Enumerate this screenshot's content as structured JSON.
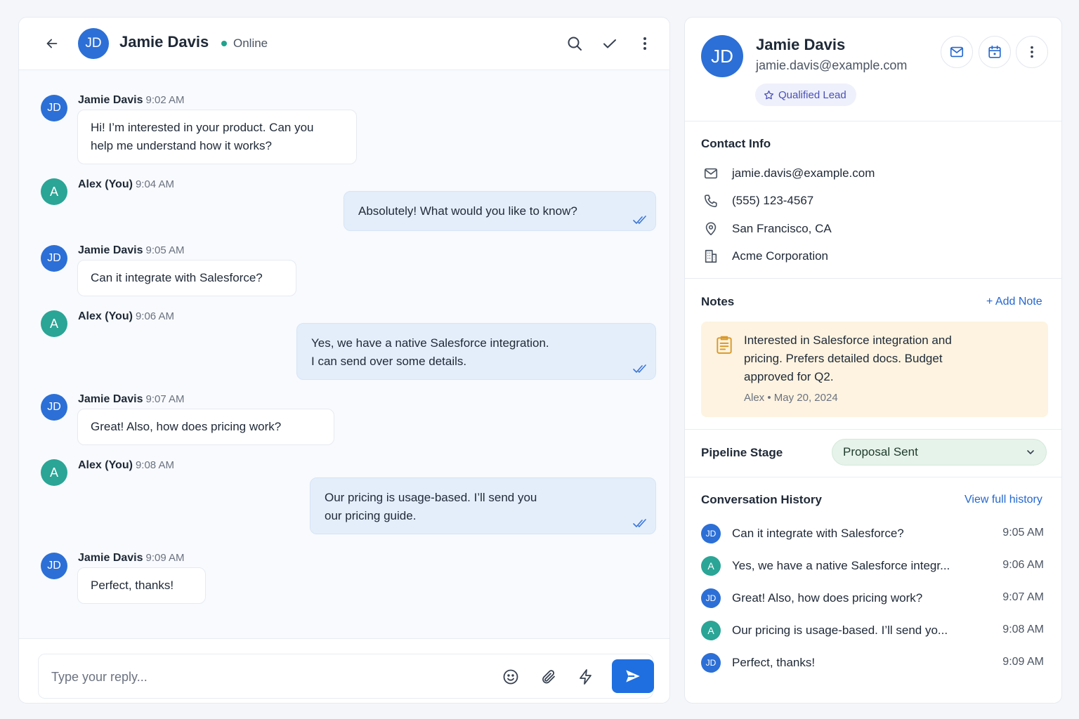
{
  "chat": {
    "contact_initials": "JD",
    "contact_name": "Jamie Davis",
    "status": "Online",
    "messages": [
      {
        "initials": "JD",
        "sender": "Jamie Davis",
        "time": "9:02 AM",
        "line1": "Hi! I’m interested in your product. Can you",
        "line2": "help me understand how it works?"
      },
      {
        "initials": "A",
        "sender": "Alex (You)",
        "time": "9:04 AM",
        "line1": "Absolutely! What would you like to know?"
      },
      {
        "initials": "JD",
        "sender": "Jamie Davis",
        "time": "9:05 AM",
        "line1": "Can it integrate with Salesforce?"
      },
      {
        "initials": "A",
        "sender": "Alex (You)",
        "time": "9:06 AM",
        "line1": "Yes, we have a native Salesforce integration.",
        "line2": "I can send over some details."
      },
      {
        "initials": "JD",
        "sender": "Jamie Davis",
        "time": "9:07 AM",
        "line1": "Great! Also, how does pricing work?"
      },
      {
        "initials": "A",
        "sender": "Alex (You)",
        "time": "9:08 AM",
        "line1": "Our pricing is usage-based. I’ll send you",
        "line2": "our pricing guide."
      },
      {
        "initials": "JD",
        "sender": "Jamie Davis",
        "time": "9:09 AM",
        "line1": "Perfect, thanks!"
      }
    ],
    "composer_placeholder": "Type your reply..."
  },
  "profile": {
    "initials": "JD",
    "name": "Jamie Davis",
    "email": "jamie.davis@example.com",
    "badge": "Qualified Lead"
  },
  "contact_info": {
    "title": "Contact Info",
    "email": "jamie.davis@example.com",
    "phone": "(555) 123-4567",
    "location": "San Francisco, CA",
    "company": "Acme Corporation"
  },
  "notes": {
    "title": "Notes",
    "add_label": "+ Add Note",
    "line1": "Interested in Salesforce integration and",
    "line2": "pricing. Prefers detailed docs. Budget",
    "line3": "approved for Q2.",
    "meta": "Alex • May 20, 2024"
  },
  "pipeline": {
    "title": "Pipeline Stage",
    "value": "Proposal Sent"
  },
  "history": {
    "title": "Conversation History",
    "link": "View full history",
    "items": [
      {
        "initials": "JD",
        "text": "Can it integrate with Salesforce?",
        "time": "9:05 AM"
      },
      {
        "initials": "A",
        "text": "Yes, we have a native Salesforce integr...",
        "time": "9:06 AM"
      },
      {
        "initials": "JD",
        "text": "Great! Also, how does pricing work?",
        "time": "9:07 AM"
      },
      {
        "initials": "A",
        "text": "Our pricing is usage-based. I’ll send yo...",
        "time": "9:08 AM"
      },
      {
        "initials": "JD",
        "text": "Perfect, thanks!",
        "time": "9:09 AM"
      }
    ]
  },
  "colors": {
    "brand_blue": "#2c6fd6",
    "teal": "#2aa596",
    "outgoing_bubble": "#e4eefb",
    "note_bg": "#fdf3e0",
    "stage_bg": "#e6f3ea",
    "send_button": "#1f6fe0"
  },
  "icons": {
    "back": "arrow-left-icon",
    "search": "search-icon",
    "resolve": "check-icon",
    "more": "more-vertical-icon",
    "emoji": "smile-icon",
    "attach": "paperclip-icon",
    "quick_reply": "lightning-icon",
    "send": "send-icon",
    "email": "mail-icon",
    "schedule": "calendar-icon",
    "phone": "phone-icon",
    "location": "map-pin-icon",
    "company": "building-icon",
    "note": "clipboard-icon",
    "dropdown": "chevron-down-icon",
    "badge": "star-icon",
    "read_receipt": "double-check-icon"
  }
}
